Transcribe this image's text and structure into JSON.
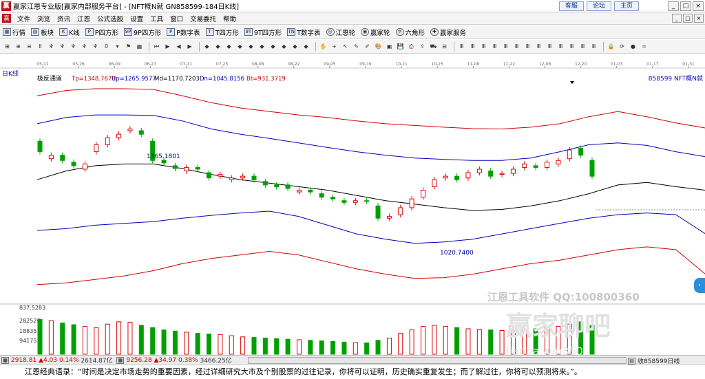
{
  "window": {
    "logo_glyph": "赢",
    "title": "赢家江恩专业版[赢家内部服务平台] - [NFT概N就  GN858599-184日K线]",
    "links": [
      "客服",
      "论坛",
      "主页"
    ],
    "controls": [
      "_",
      "□",
      "×"
    ],
    "menu_controls": [
      "_",
      "□",
      "×"
    ]
  },
  "menu": {
    "items": [
      "文件",
      "浏览",
      "资讯",
      "江恩",
      "公式选股",
      "设置",
      "工具",
      "窗口",
      "交易委托",
      "帮助"
    ]
  },
  "toolbar1": {
    "items": [
      {
        "icon": "grid-icon",
        "glyph": "▦",
        "label": "行情"
      },
      {
        "icon": "blocks-icon",
        "glyph": "▤",
        "label": "板块"
      },
      {
        "icon": "candle-icon",
        "glyph": "K",
        "label": "K线"
      },
      {
        "icon": "square-p-icon",
        "glyph": "P",
        "label": "P四方形"
      },
      {
        "icon": "square-9p-icon",
        "glyph": "9P",
        "label": "9P四方形"
      },
      {
        "icon": "table-p-icon",
        "glyph": "P",
        "label": "P数字表"
      },
      {
        "icon": "square-t-icon",
        "glyph": "T",
        "label": "T四方形"
      },
      {
        "icon": "square-9t-icon",
        "glyph": "9T",
        "label": "9T四方形"
      },
      {
        "icon": "table-t-icon",
        "glyph": "TN",
        "label": "T数字表"
      },
      {
        "icon": "wheel-icon",
        "glyph": "◎",
        "label": "江恩轮"
      },
      {
        "icon": "wheel2-icon",
        "glyph": "◉",
        "label": "赢家轮"
      },
      {
        "icon": "hexagon-icon",
        "glyph": "✡",
        "label": "六角形"
      },
      {
        "icon": "service-icon",
        "glyph": "✚",
        "label": "赢家服务"
      }
    ]
  },
  "toolbar2": {
    "icons": [
      {
        "name": "layout-icon",
        "glyph": "⊞"
      },
      {
        "name": "zoom-in-icon",
        "glyph": "⊕"
      },
      {
        "name": "zoom-out-icon",
        "glyph": "⊖"
      },
      {
        "name": "period-icon",
        "glyph": "Ⅱ"
      },
      {
        "name": "kline-a-icon",
        "glyph": "♆"
      },
      {
        "name": "kline-b-icon",
        "glyph": "♆"
      },
      {
        "name": "kline-c-icon",
        "glyph": "♆"
      },
      {
        "name": "kline-d-icon",
        "glyph": "♆"
      },
      {
        "name": "kline-e-icon",
        "glyph": "♆"
      },
      {
        "name": "zero-icon",
        "glyph": "0"
      },
      {
        "name": "dropdown-icon",
        "glyph": "▾"
      },
      {
        "name": "flag-icon",
        "glyph": "⚑"
      },
      {
        "name": "chart-type-icon",
        "glyph": "▦"
      },
      {
        "name": "first-icon",
        "glyph": "⏮"
      },
      {
        "name": "next-bar-icon",
        "glyph": "▶"
      },
      {
        "name": "prev-icon",
        "glyph": "◀"
      },
      {
        "name": "play-icon",
        "glyph": "▶"
      },
      {
        "name": "diamond-a-icon",
        "glyph": "◆"
      },
      {
        "name": "diamond-b-icon",
        "glyph": "◆"
      },
      {
        "name": "diamond-c-icon",
        "glyph": "◆"
      },
      {
        "name": "diamond-d-icon",
        "glyph": "◆"
      },
      {
        "name": "diamond-e-icon",
        "glyph": "◆"
      },
      {
        "name": "diamond-f-icon",
        "glyph": "◆"
      },
      {
        "name": "diamond-g-icon",
        "glyph": "◆"
      },
      {
        "name": "diamond-h-icon",
        "glyph": "◆"
      },
      {
        "name": "diamond-i-icon",
        "glyph": "◆"
      },
      {
        "name": "diamond-j-icon",
        "glyph": "◆"
      },
      {
        "name": "hand-icon",
        "glyph": "✋"
      },
      {
        "name": "cross-icon",
        "glyph": "+"
      },
      {
        "name": "arrow-icon",
        "glyph": "↖"
      },
      {
        "name": "pencil-icon",
        "glyph": "✎"
      },
      {
        "name": "eraser-icon",
        "glyph": "✐"
      },
      {
        "name": "palette-icon",
        "glyph": "🎨"
      },
      {
        "name": "photo-icon",
        "glyph": "▣"
      },
      {
        "name": "save-icon",
        "glyph": "💾"
      },
      {
        "name": "print-icon",
        "glyph": "⎙"
      },
      {
        "name": "export-icon",
        "glyph": "⇪"
      },
      {
        "name": "car-icon",
        "glyph": "⛟"
      },
      {
        "name": "ruler-icon",
        "glyph": "⊟"
      },
      {
        "name": "bars-a-icon",
        "glyph": "Ⅲ"
      },
      {
        "name": "bars-b-icon",
        "glyph": "Ⅲ"
      },
      {
        "name": "bars-c-icon",
        "glyph": "Ⅲ"
      },
      {
        "name": "bars-d-icon",
        "glyph": "Ⅲ"
      },
      {
        "name": "bars-e-icon",
        "glyph": "Ⅲ"
      },
      {
        "name": "bars-f-icon",
        "glyph": "Ⅲ"
      },
      {
        "name": "bars-g-icon",
        "glyph": "Ⅲ"
      },
      {
        "name": "bars-h-icon",
        "glyph": "Ⅲ"
      },
      {
        "name": "bars-i-icon",
        "glyph": "Ⅲ"
      },
      {
        "name": "bars-j-icon",
        "glyph": "Ⅲ"
      },
      {
        "name": "bars-k-icon",
        "glyph": "Ⅲ"
      },
      {
        "name": "bars-l-icon",
        "glyph": "Ⅲ"
      },
      {
        "name": "bars-m-icon",
        "glyph": "Ⅲ"
      },
      {
        "name": "lock-icon",
        "glyph": "🔒"
      },
      {
        "name": "sync-icon",
        "glyph": "⟳"
      },
      {
        "name": "globe-icon",
        "glyph": "●"
      },
      {
        "name": "infinity-icon",
        "glyph": "∞"
      }
    ]
  },
  "chart": {
    "period_label": "日K线",
    "indicator_name": "极反通道",
    "params": [
      {
        "key": "Tp",
        "value": "Tp=1348.7678",
        "color": "#d00000"
      },
      {
        "key": "Up",
        "value": "Up=1265.9577",
        "color": "#0000c0"
      },
      {
        "key": "Md",
        "value": "Md=1170.7203",
        "color": "#000000"
      },
      {
        "key": "Dn",
        "value": "Dn=1045.8156",
        "color": "#0000c0"
      },
      {
        "key": "Bt",
        "value": "Bt=931.3719",
        "color": "#d00000"
      }
    ],
    "symbol_label": "858599 NFT概N就",
    "dates": [
      "05-12",
      "05-26",
      "06-09",
      "06-27",
      "07-11",
      "07-25",
      "08-08",
      "08-22",
      "09-05",
      "09-19",
      "10-11",
      "10-25",
      "11-08",
      "11-22",
      "12-06",
      "12-20",
      "01-03",
      "01-17",
      "01-31"
    ],
    "high_label": "1365.1801",
    "low_label": "1020.7400",
    "volume_ticks": [
      "837.5283",
      "282526",
      "188351",
      "94175"
    ],
    "watermark_line1": "江恩工具软件  QQ:100800360",
    "watermark_line2": "赢家聊吧",
    "watermark_line3": "liaoba.win360"
  },
  "chart_data": {
    "type": "candlestick",
    "ylim": [
      880,
      1460
    ],
    "volume_ylim": [
      0,
      380000
    ],
    "channels": [
      {
        "name": "Tp",
        "color": "#d00000",
        "values": [
          1440,
          1455,
          1460,
          1460,
          1458,
          1440,
          1420,
          1405,
          1395,
          1385,
          1378,
          1368,
          1360,
          1355,
          1350,
          1346,
          1345,
          1350,
          1360,
          1380,
          1395,
          1380,
          1362,
          1348
        ]
      },
      {
        "name": "Up",
        "color": "#0000c0",
        "values": [
          1360,
          1378,
          1385,
          1385,
          1384,
          1368,
          1345,
          1330,
          1318,
          1305,
          1292,
          1280,
          1270,
          1262,
          1258,
          1255,
          1255,
          1262,
          1280,
          1300,
          1305,
          1298,
          1280,
          1266
        ]
      },
      {
        "name": "Md",
        "color": "#000000",
        "values": [
          1200,
          1225,
          1240,
          1245,
          1245,
          1232,
          1215,
          1200,
          1190,
          1180,
          1170,
          1155,
          1140,
          1130,
          1120,
          1112,
          1115,
          1125,
          1140,
          1160,
          1185,
          1192,
          1180,
          1170
        ]
      },
      {
        "name": "Dn",
        "color": "#0000c0",
        "values": [
          1055,
          1060,
          1070,
          1075,
          1080,
          1090,
          1098,
          1105,
          1110,
          1095,
          1070,
          1045,
          1030,
          1018,
          1022,
          1030,
          1045,
          1060,
          1075,
          1090,
          1100,
          1105,
          1100,
          1046
        ]
      },
      {
        "name": "Bt",
        "color": "#d00000",
        "values": [
          900,
          905,
          915,
          925,
          940,
          960,
          975,
          985,
          995,
          985,
          965,
          945,
          930,
          918,
          920,
          930,
          945,
          960,
          970,
          985,
          1000,
          1008,
          1000,
          931
        ]
      }
    ],
    "candles": [
      [
        1310,
        1280
      ],
      [
        1260,
        1270
      ],
      [
        1270,
        1255
      ],
      [
        1250,
        1240
      ],
      [
        1230,
        1245
      ],
      [
        1280,
        1300
      ],
      [
        1300,
        1320
      ],
      [
        1320,
        1330
      ],
      [
        1340,
        1345
      ],
      [
        1340,
        1330
      ],
      [
        1310,
        1255
      ],
      [
        1255,
        1248
      ],
      [
        1240,
        1232
      ],
      [
        1225,
        1235
      ],
      [
        1235,
        1230
      ],
      [
        1220,
        1205
      ],
      [
        1210,
        1215
      ],
      [
        1200,
        1205
      ],
      [
        1205,
        1210
      ],
      [
        1210,
        1200
      ],
      [
        1195,
        1185
      ],
      [
        1185,
        1180
      ],
      [
        1185,
        1175
      ],
      [
        1165,
        1170
      ],
      [
        1170,
        1165
      ],
      [
        1160,
        1150
      ],
      [
        1150,
        1145
      ],
      [
        1140,
        1135
      ],
      [
        1135,
        1140
      ],
      [
        1140,
        1138
      ],
      [
        1125,
        1090
      ],
      [
        1090,
        1095
      ],
      [
        1100,
        1120
      ],
      [
        1120,
        1145
      ],
      [
        1150,
        1170
      ],
      [
        1180,
        1200
      ],
      [
        1205,
        1210
      ],
      [
        1210,
        1200
      ],
      [
        1205,
        1220
      ],
      [
        1220,
        1230
      ],
      [
        1225,
        1210
      ],
      [
        1215,
        1218
      ],
      [
        1218,
        1230
      ],
      [
        1235,
        1245
      ],
      [
        1240,
        1235
      ],
      [
        1235,
        1250
      ],
      [
        1245,
        1255
      ],
      [
        1260,
        1285
      ],
      [
        1290,
        1270
      ],
      [
        1255,
        1210
      ]
    ],
    "volumes": [
      300000,
      290000,
      270000,
      255000,
      240000,
      230000,
      260000,
      280000,
      275000,
      250000,
      230000,
      210000,
      200000,
      190000,
      180000,
      175000,
      170000,
      160000,
      150000,
      145000,
      140000,
      135000,
      130000,
      125000,
      120000,
      115000,
      110000,
      105000,
      100000,
      98000,
      120000,
      140000,
      180000,
      210000,
      240000,
      250000,
      240000,
      230000,
      220000,
      215000,
      210000,
      205000,
      200000,
      210000,
      220000,
      230000,
      240000,
      260000,
      280000,
      250000
    ]
  },
  "status": {
    "idx1_price": "2918.81",
    "idx1_change": "▲4.03",
    "idx1_pct": "0.14%",
    "idx1_amount": "2614.87亿",
    "idx2_price": "9256.28",
    "idx2_change": "▲34.97",
    "idx2_pct": "0.38%",
    "idx2_amount": "3466.25亿",
    "right_label": "收858599日线"
  },
  "quote": {
    "text": "江恩经典语录：“时间是决定市场走势的重要因素，经过详细研究大市及个别股票的过往记录，你将可以证明，历史确实重复发生；而了解过往，你将可以预测将来。”。"
  }
}
